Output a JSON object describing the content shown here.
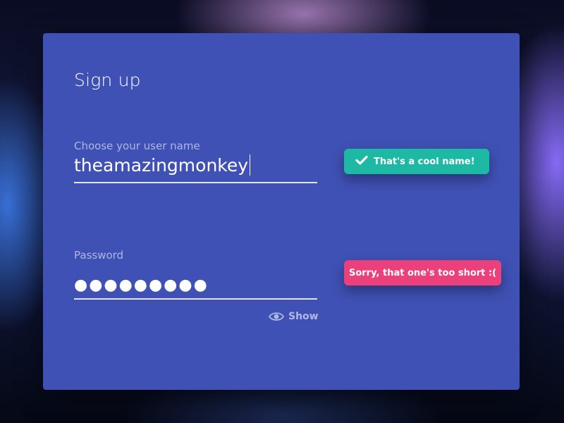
{
  "form": {
    "title": "Sign up",
    "username": {
      "label": "Choose your user name",
      "value": "theamazingmonkey"
    },
    "password": {
      "label": "Password",
      "masked_value": "●●●●●●●●●",
      "show_label": "Show"
    }
  },
  "validation": {
    "username_message": "That's a cool name!",
    "password_message": "Sorry, that one's too short :("
  },
  "icons": {
    "success": "checkmark-icon",
    "show": "eye-icon"
  },
  "colors": {
    "card": "#3f51b5",
    "success": "#1eb9a5",
    "error": "#ec407a"
  }
}
